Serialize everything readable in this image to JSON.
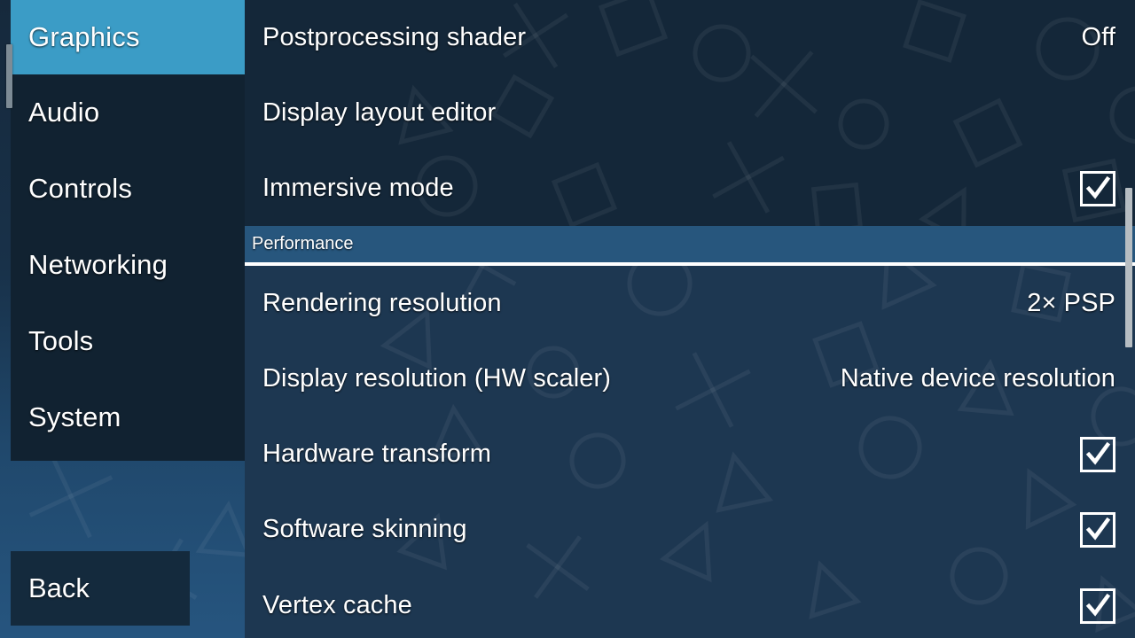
{
  "colors": {
    "accent": "#3b9cc6",
    "sidebar_panel": "#112231",
    "main_bg": "#1d3751",
    "main_upper": "#142739",
    "section_header_bg": "#27567d",
    "text": "#ffffff",
    "scrollbar_thumb": "#b6bdc2"
  },
  "sidebar": {
    "items": [
      {
        "label": "Graphics",
        "selected": true
      },
      {
        "label": "Audio",
        "selected": false
      },
      {
        "label": "Controls",
        "selected": false
      },
      {
        "label": "Networking",
        "selected": false
      },
      {
        "label": "Tools",
        "selected": false
      },
      {
        "label": "System",
        "selected": false
      }
    ],
    "back_label": "Back"
  },
  "main": {
    "rows": [
      {
        "label": "Postprocessing shader",
        "value": "Off",
        "type": "value"
      },
      {
        "label": "Display layout editor",
        "value": "",
        "type": "link"
      },
      {
        "label": "Immersive mode",
        "value": "checked",
        "type": "checkbox"
      }
    ],
    "section": {
      "title": "Performance",
      "rows": [
        {
          "label": "Rendering resolution",
          "value": "2× PSP",
          "type": "value"
        },
        {
          "label": "Display resolution (HW scaler)",
          "value": "Native device resolution",
          "type": "value"
        },
        {
          "label": "Hardware transform",
          "value": "checked",
          "type": "checkbox"
        },
        {
          "label": "Software skinning",
          "value": "checked",
          "type": "checkbox"
        },
        {
          "label": "Vertex cache",
          "value": "checked",
          "type": "checkbox"
        }
      ]
    }
  }
}
